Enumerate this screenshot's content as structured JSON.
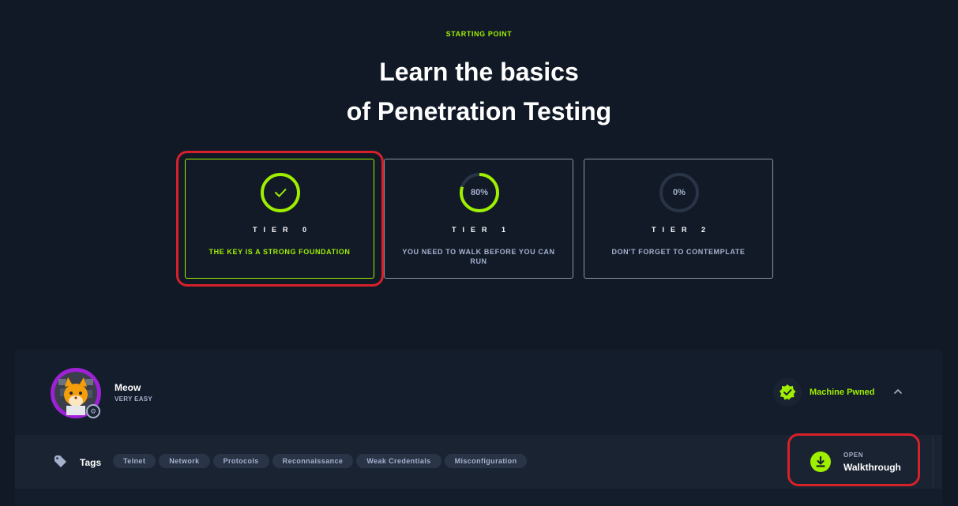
{
  "header": {
    "eyebrow": "STARTING POINT",
    "title_line1": "Learn the basics",
    "title_line2": "of Penetration Testing"
  },
  "tiers": [
    {
      "label": "TIER 0",
      "description": "THE KEY IS A STRONG FOUNDATION",
      "progress_percent": 100,
      "completed": true,
      "progress_text": ""
    },
    {
      "label": "TIER 1",
      "description": "YOU NEED TO WALK BEFORE YOU CAN RUN",
      "progress_percent": 80,
      "completed": false,
      "progress_text": "80%"
    },
    {
      "label": "TIER 2",
      "description": "DON'T FORGET TO CONTEMPLATE",
      "progress_percent": 0,
      "completed": false,
      "progress_text": "0%"
    }
  ],
  "machine": {
    "name": "Meow",
    "difficulty": "VERY EASY",
    "status": "Machine Pwned",
    "tags_label": "Tags",
    "tags": [
      "Telnet",
      "Network",
      "Protocols",
      "Reconnaissance",
      "Weak Credentials",
      "Misconfiguration"
    ],
    "walkthrough_eyebrow": "OPEN",
    "walkthrough_label": "Walkthrough"
  },
  "colors": {
    "accent": "#9fef00",
    "background": "#111927",
    "panel": "#141d2b",
    "highlight": "#d7212a",
    "muted_text": "#a4b1cd"
  },
  "icons": {
    "tier0": "check-icon",
    "status": "verified-badge-icon",
    "collapse": "chevron-up-icon",
    "tags": "tag-icon",
    "walkthrough": "download-icon"
  }
}
